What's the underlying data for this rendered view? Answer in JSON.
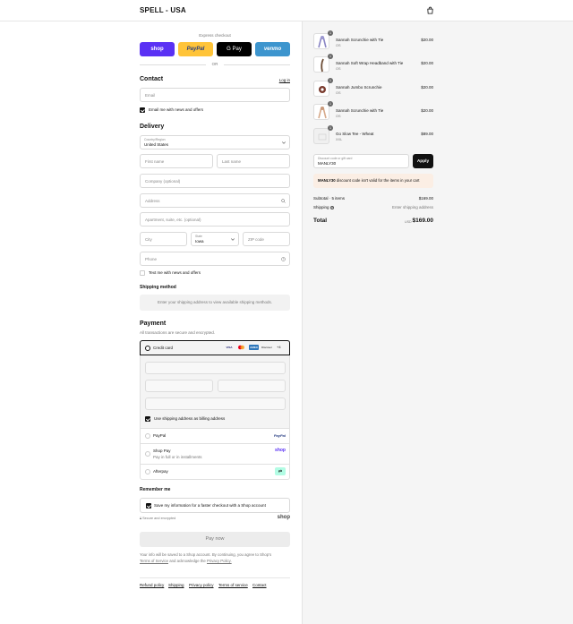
{
  "header": {
    "brand": "SPELL - USA"
  },
  "express": {
    "label": "Express checkout",
    "buttons": [
      {
        "name": "shop",
        "label": "shop",
        "bg": "#5a31f4",
        "fg": "#ffffff"
      },
      {
        "name": "paypal",
        "label": "PayPal",
        "bg": "#ffc439",
        "fg": "#253b80"
      },
      {
        "name": "gpay",
        "label": "G Pay",
        "bg": "#000000",
        "fg": "#ffffff"
      },
      {
        "name": "venmo",
        "label": "venmo",
        "bg": "#3d95ce",
        "fg": "#ffffff"
      }
    ],
    "or": "OR"
  },
  "contact": {
    "title": "Contact",
    "login": "Log in",
    "email_placeholder": "Email",
    "newsletter": "Email me with news and offers"
  },
  "delivery": {
    "title": "Delivery",
    "country_label": "Country/Region",
    "country_value": "United States",
    "first_name": "First name",
    "last_name": "Last name",
    "company": "Company (optional)",
    "address": "Address",
    "apartment": "Apartment, suite, etc. (optional)",
    "city": "City",
    "state_label": "State",
    "state_value": "Iowa",
    "zip": "ZIP code",
    "phone": "Phone",
    "sms": "Text me with news and offers"
  },
  "shipping": {
    "title": "Shipping method",
    "note": "Enter your shipping address to view available shipping methods."
  },
  "payment": {
    "title": "Payment",
    "subtitle": "All transactions are secure and encrypted.",
    "credit_card": "Credit card",
    "card_more": "+4",
    "billing_same": "Use shipping address as billing address",
    "paypal": "PayPal",
    "shop_pay": "Shop Pay",
    "shop_pay_sub": "Pay in full or in installments",
    "afterpay": "Afterpay"
  },
  "remember": {
    "title": "Remember me",
    "save_info": "Save my information for a faster checkout with a Shop account",
    "secure": "Secure and encrypted",
    "shop_logo": "shop"
  },
  "pay_now": "Pay now",
  "legal": {
    "text1": "Your info will be saved to a Shop account. By continuing, you agree to Shop's",
    "terms": "Terms of Service",
    "and": "and acknowledge the",
    "privacy": "Privacy Policy."
  },
  "footer": {
    "links": [
      "Refund policy",
      "Shipping",
      "Privacy policy",
      "Terms of service",
      "Contact"
    ]
  },
  "cart": {
    "items": [
      {
        "qty": "1",
        "name": "Sannah Scrunchie with Tie",
        "variant": "OS",
        "price": "$20.00"
      },
      {
        "qty": "1",
        "name": "Sannah Soft Wrap Headband with Tie",
        "variant": "OS",
        "price": "$20.00"
      },
      {
        "qty": "1",
        "name": "Sannah Jumbo Scrunchie",
        "variant": "OS",
        "price": "$20.00"
      },
      {
        "qty": "1",
        "name": "Sannah Scrunchie with Tie",
        "variant": "OS",
        "price": "$20.00"
      },
      {
        "qty": "1",
        "name": "Go Slow Tee - Wheat",
        "variant": "XXL",
        "price": "$89.00"
      }
    ],
    "discount_label": "Discount code or gift card",
    "discount_value": "MANLY30",
    "apply": "Apply",
    "discount_error_code": "MANLY30",
    "discount_error_text": "discount code isn't valid for the items in your cart",
    "subtotal_label": "Subtotal · 5 items",
    "subtotal_value": "$169.00",
    "shipping_label": "Shipping",
    "shipping_value": "Enter shipping address",
    "total_label": "Total",
    "currency": "USD",
    "total_value": "$169.00"
  }
}
